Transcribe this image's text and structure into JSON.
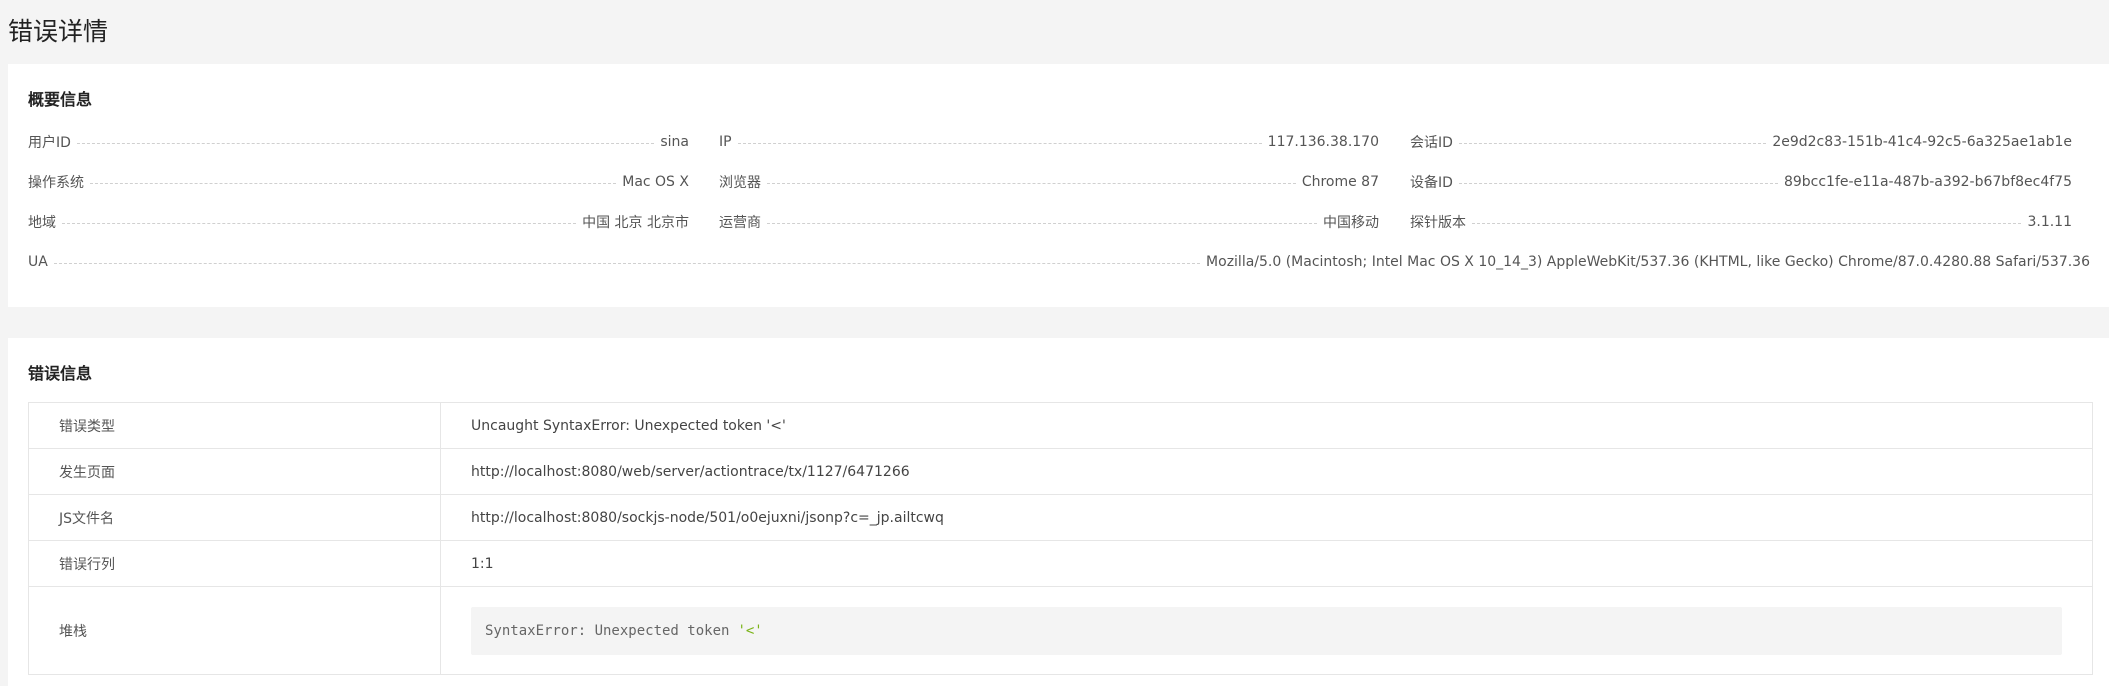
{
  "page": {
    "title": "错误详情"
  },
  "overview": {
    "title": "概要信息",
    "rows": [
      [
        {
          "label": "用户ID",
          "value": "sina"
        },
        {
          "label": "IP",
          "value": "117.136.38.170"
        },
        {
          "label": "会话ID",
          "value": "2e9d2c83-151b-41c4-92c5-6a325ae1ab1e"
        }
      ],
      [
        {
          "label": "操作系统",
          "value": "Mac OS X"
        },
        {
          "label": "浏览器",
          "value": "Chrome 87"
        },
        {
          "label": "设备ID",
          "value": "89bcc1fe-e11a-487b-a392-b67bf8ec4f75"
        }
      ],
      [
        {
          "label": "地域",
          "value": "中国 北京 北京市"
        },
        {
          "label": "运营商",
          "value": "中国移动"
        },
        {
          "label": "探针版本",
          "value": "3.1.11"
        }
      ]
    ],
    "ua": {
      "label": "UA",
      "value": "Mozilla/5.0 (Macintosh; Intel Mac OS X 10_14_3) AppleWebKit/537.36 (KHTML, like Gecko) Chrome/87.0.4280.88 Safari/537.36"
    }
  },
  "error": {
    "title": "错误信息",
    "rows": [
      {
        "label": "错误类型",
        "value": "Uncaught SyntaxError: Unexpected token '<'"
      },
      {
        "label": "发生页面",
        "value": "http://localhost:8080/web/server/actiontrace/tx/1127/6471266"
      },
      {
        "label": "JS文件名",
        "value": "http://localhost:8080/sockjs-node/501/o0ejuxni/jsonp?c=_jp.ailtcwq"
      },
      {
        "label": "错误行列",
        "value": "1:1"
      }
    ],
    "stack": {
      "label": "堆栈",
      "text": "SyntaxError: Unexpected token",
      "token": "'<'"
    }
  }
}
